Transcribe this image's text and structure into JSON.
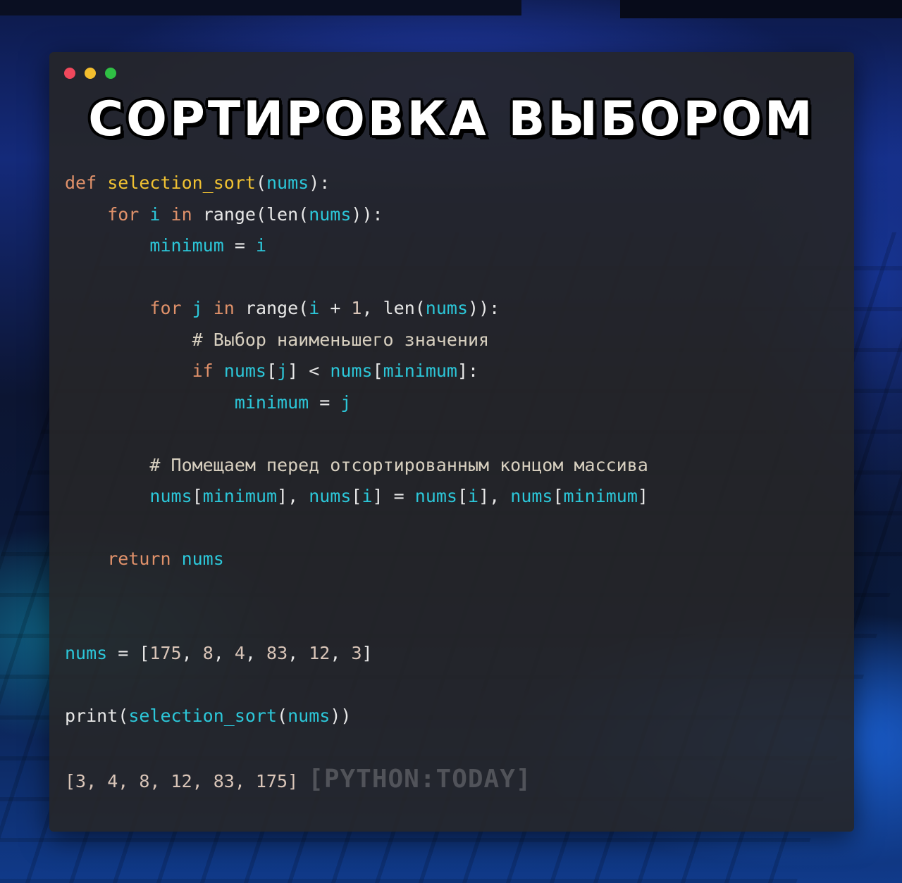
{
  "window": {
    "title": "СОРТИРОВКА ВЫБОРОМ"
  },
  "code": {
    "lines": [
      [
        {
          "t": "def ",
          "c": "kw"
        },
        {
          "t": "selection_sort",
          "c": "fn"
        },
        {
          "t": "(",
          "c": "plain"
        },
        {
          "t": "nums",
          "c": "var"
        },
        {
          "t": "):",
          "c": "plain"
        }
      ],
      [
        {
          "t": "    for ",
          "c": "kw"
        },
        {
          "t": "i ",
          "c": "var"
        },
        {
          "t": "in ",
          "c": "kw"
        },
        {
          "t": "range(len(",
          "c": "plain"
        },
        {
          "t": "nums",
          "c": "var"
        },
        {
          "t": ")):",
          "c": "plain"
        }
      ],
      [
        {
          "t": "        minimum ",
          "c": "var"
        },
        {
          "t": "= ",
          "c": "plain"
        },
        {
          "t": "i",
          "c": "var"
        }
      ],
      [],
      [
        {
          "t": "        for ",
          "c": "kw"
        },
        {
          "t": "j ",
          "c": "var"
        },
        {
          "t": "in ",
          "c": "kw"
        },
        {
          "t": "range(",
          "c": "plain"
        },
        {
          "t": "i ",
          "c": "var"
        },
        {
          "t": "+ ",
          "c": "plain"
        },
        {
          "t": "1",
          "c": "num"
        },
        {
          "t": ", len(",
          "c": "plain"
        },
        {
          "t": "nums",
          "c": "var"
        },
        {
          "t": ")):",
          "c": "plain"
        }
      ],
      [
        {
          "t": "            # Выбор наименьшего значения",
          "c": "cmt"
        }
      ],
      [
        {
          "t": "            if ",
          "c": "kw"
        },
        {
          "t": "nums",
          "c": "var"
        },
        {
          "t": "[",
          "c": "plain"
        },
        {
          "t": "j",
          "c": "var"
        },
        {
          "t": "] < ",
          "c": "plain"
        },
        {
          "t": "nums",
          "c": "var"
        },
        {
          "t": "[",
          "c": "plain"
        },
        {
          "t": "minimum",
          "c": "var"
        },
        {
          "t": "]:",
          "c": "plain"
        }
      ],
      [
        {
          "t": "                minimum ",
          "c": "var"
        },
        {
          "t": "= ",
          "c": "plain"
        },
        {
          "t": "j",
          "c": "var"
        }
      ],
      [],
      [
        {
          "t": "        # Помещаем перед отсортированным концом массива",
          "c": "cmt"
        }
      ],
      [
        {
          "t": "        nums",
          "c": "var"
        },
        {
          "t": "[",
          "c": "plain"
        },
        {
          "t": "minimum",
          "c": "var"
        },
        {
          "t": "], ",
          "c": "plain"
        },
        {
          "t": "nums",
          "c": "var"
        },
        {
          "t": "[",
          "c": "plain"
        },
        {
          "t": "i",
          "c": "var"
        },
        {
          "t": "] = ",
          "c": "plain"
        },
        {
          "t": "nums",
          "c": "var"
        },
        {
          "t": "[",
          "c": "plain"
        },
        {
          "t": "i",
          "c": "var"
        },
        {
          "t": "], ",
          "c": "plain"
        },
        {
          "t": "nums",
          "c": "var"
        },
        {
          "t": "[",
          "c": "plain"
        },
        {
          "t": "minimum",
          "c": "var"
        },
        {
          "t": "]",
          "c": "plain"
        }
      ],
      [],
      [
        {
          "t": "    return ",
          "c": "kw"
        },
        {
          "t": "nums",
          "c": "var"
        }
      ],
      [],
      [],
      [
        {
          "t": "nums ",
          "c": "var"
        },
        {
          "t": "= [",
          "c": "plain"
        },
        {
          "t": "175",
          "c": "num"
        },
        {
          "t": ", ",
          "c": "plain"
        },
        {
          "t": "8",
          "c": "num"
        },
        {
          "t": ", ",
          "c": "plain"
        },
        {
          "t": "4",
          "c": "num"
        },
        {
          "t": ", ",
          "c": "plain"
        },
        {
          "t": "83",
          "c": "num"
        },
        {
          "t": ", ",
          "c": "plain"
        },
        {
          "t": "12",
          "c": "num"
        },
        {
          "t": ", ",
          "c": "plain"
        },
        {
          "t": "3",
          "c": "num"
        },
        {
          "t": "]",
          "c": "plain"
        }
      ],
      [],
      [
        {
          "t": "print(",
          "c": "plain"
        },
        {
          "t": "selection_sort",
          "c": "var"
        },
        {
          "t": "(",
          "c": "plain"
        },
        {
          "t": "nums",
          "c": "var"
        },
        {
          "t": "))",
          "c": "plain"
        }
      ]
    ]
  },
  "output": {
    "text": "[3, 4, 8, 12, 83, 175]",
    "watermark": "[PYTHON:TODAY]"
  },
  "colors": {
    "keyword": "#e0916a",
    "function": "#f1c232",
    "variable": "#2cc7d9",
    "number": "#d9c5b8",
    "text": "#e8e8e8",
    "comment": "#d8d0c0",
    "dot_red": "#f0485c",
    "dot_yellow": "#f3be2e",
    "dot_green": "#2fbf44"
  },
  "icons": [
    "close-dot-icon",
    "minimize-dot-icon",
    "maximize-dot-icon"
  ]
}
